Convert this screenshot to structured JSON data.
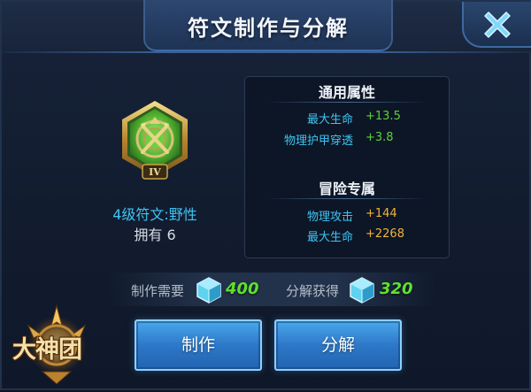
{
  "title": "符文制作与分解",
  "rune": {
    "name": "4级符文:野性",
    "owned": "拥有 6",
    "tier_numeral": "IV"
  },
  "attributes": {
    "general": {
      "heading": "通用属性",
      "items": [
        {
          "label": "最大生命",
          "value": "+13.5"
        },
        {
          "label": "物理护甲穿透",
          "value": "+3.8"
        }
      ]
    },
    "adventure": {
      "heading": "冒险专属",
      "items": [
        {
          "label": "物理攻击",
          "value": "+144"
        },
        {
          "label": "最大生命",
          "value": "+2268"
        }
      ]
    }
  },
  "cost": {
    "craft_label": "制作需要",
    "craft_amount": "400",
    "decompose_label": "分解获得",
    "decompose_amount": "320",
    "currency_icon": "crystal-icon"
  },
  "buttons": {
    "craft": "制作",
    "decompose": "分解"
  },
  "logo_text": "大神团",
  "colors": {
    "accent_cyan": "#3fc4f2",
    "general_value": "#5fd03a",
    "adventure_value": "#f0b43a",
    "cost_green": "#5fe12d",
    "button_blue": "#2d78c8"
  }
}
